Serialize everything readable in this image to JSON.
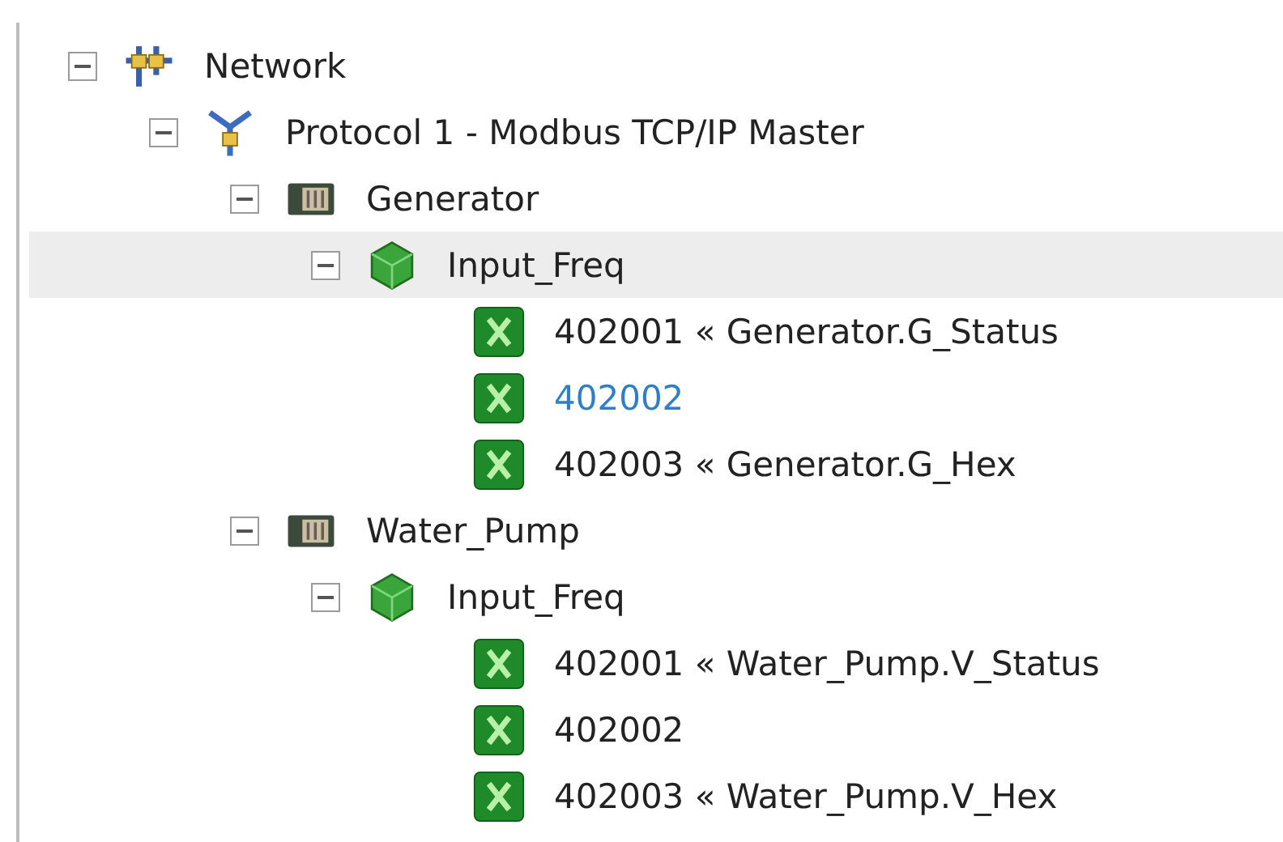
{
  "tree": [
    {
      "kind": "network",
      "label": "Network",
      "expanded": true,
      "selected": false,
      "children": [
        {
          "kind": "protocol",
          "label": "Protocol 1 - Modbus TCP/IP Master",
          "expanded": true,
          "selected": false,
          "children": [
            {
              "kind": "device",
              "label": "Generator",
              "expanded": true,
              "selected": false,
              "children": [
                {
                  "kind": "group",
                  "label": "Input_Freq",
                  "expanded": true,
                  "selected": true,
                  "children": [
                    {
                      "kind": "register",
                      "label": "402001 « Generator.G_Status",
                      "selected": false,
                      "hovered": false
                    },
                    {
                      "kind": "register",
                      "label": "402002",
                      "selected": false,
                      "hovered": true
                    },
                    {
                      "kind": "register",
                      "label": "402003 « Generator.G_Hex",
                      "selected": false,
                      "hovered": false
                    }
                  ]
                }
              ]
            },
            {
              "kind": "device",
              "label": "Water_Pump",
              "expanded": true,
              "selected": false,
              "children": [
                {
                  "kind": "group",
                  "label": "Input_Freq",
                  "expanded": true,
                  "selected": false,
                  "children": [
                    {
                      "kind": "register",
                      "label": "402001 « Water_Pump.V_Status",
                      "selected": false,
                      "hovered": false
                    },
                    {
                      "kind": "register",
                      "label": "402002",
                      "selected": false,
                      "hovered": false
                    },
                    {
                      "kind": "register",
                      "label": "402003 « Water_Pump.V_Hex",
                      "selected": false,
                      "hovered": false
                    }
                  ]
                }
              ]
            }
          ]
        }
      ]
    }
  ]
}
